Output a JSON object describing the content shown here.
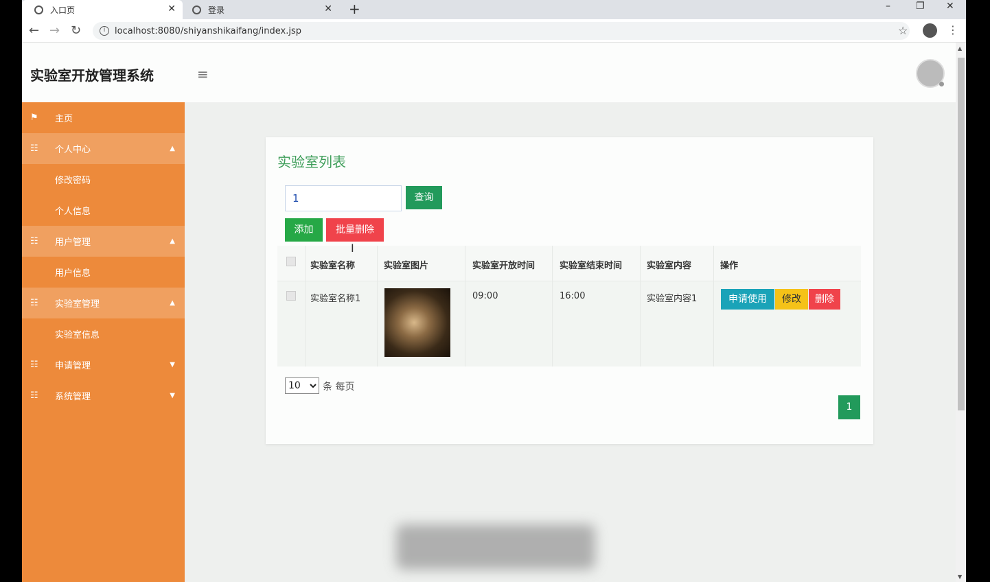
{
  "browser": {
    "tabs": [
      {
        "label": "入口页",
        "active": true
      },
      {
        "label": "登录",
        "active": false
      }
    ],
    "new_tab": "+",
    "url": "localhost:8080/shiyanshikaifang/index.jsp"
  },
  "header": {
    "title": "实验室开放管理系统"
  },
  "sidebar": {
    "items": [
      {
        "label": "主页",
        "type": "link"
      },
      {
        "label": "个人中心",
        "type": "group"
      },
      {
        "label": "修改密码",
        "type": "sub"
      },
      {
        "label": "个人信息",
        "type": "sub"
      },
      {
        "label": "用户管理",
        "type": "group"
      },
      {
        "label": "用户信息",
        "type": "sub"
      },
      {
        "label": "实验室管理",
        "type": "group"
      },
      {
        "label": "实验室信息",
        "type": "sub"
      },
      {
        "label": "申请管理",
        "type": "group"
      },
      {
        "label": "系统管理",
        "type": "group"
      }
    ]
  },
  "main": {
    "card_title": "实验室列表",
    "search": {
      "value": "1"
    },
    "buttons": {
      "query": "查询",
      "add": "添加",
      "batch_delete": "批量删除"
    },
    "table": {
      "headers": [
        "实验室名称",
        "实验室图片",
        "实验室开放时间",
        "实验室结束时间",
        "实验室内容",
        "操作"
      ],
      "rows": [
        {
          "name": "实验室名称1",
          "open_time": "09:00",
          "end_time": "16:00",
          "content": "实验室内容1",
          "actions": {
            "apply": "申请使用",
            "edit": "修改",
            "delete": "删除"
          }
        }
      ]
    },
    "pagination": {
      "page_size": "10",
      "page_size_label": "条 每页",
      "current_page": "1"
    }
  },
  "colors": {
    "sidebar": "#ed8a3b",
    "primary_green": "#229a5b",
    "title_green": "#3f9e5a",
    "danger": "#f0434b",
    "info": "#1aa3b8",
    "warning": "#f5c218"
  }
}
